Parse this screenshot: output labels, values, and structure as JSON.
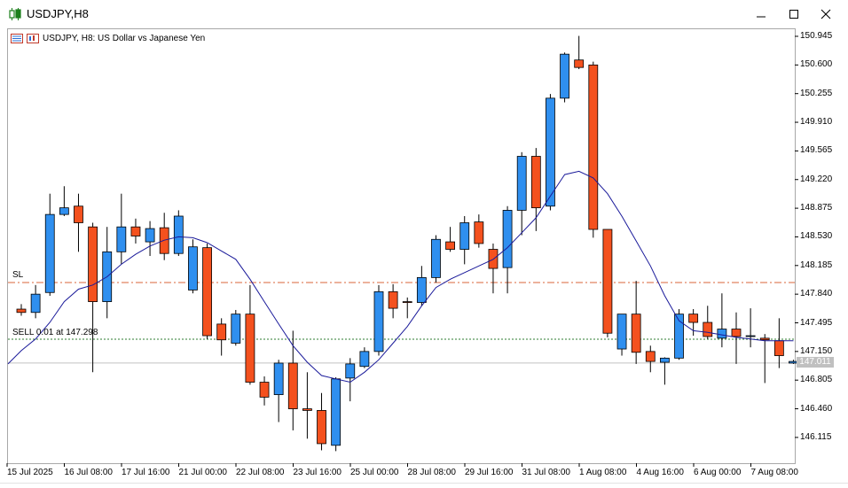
{
  "window": {
    "title": "USDJPY,H8"
  },
  "chart": {
    "header_text": "USDJPY, H8:  US Dollar vs Japanese Yen",
    "price_axis": [
      "150.945",
      "150.600",
      "150.255",
      "149.910",
      "149.565",
      "149.220",
      "148.875",
      "148.530",
      "148.185",
      "147.840",
      "147.495",
      "147.150",
      "146.805",
      "146.460",
      "146.115"
    ],
    "time_axis": [
      "15 Jul 2025",
      "16 Jul 08:00",
      "17 Jul 16:00",
      "21 Jul 00:00",
      "22 Jul 08:00",
      "23 Jul 16:00",
      "25 Jul 00:00",
      "28 Jul 08:00",
      "29 Jul 16:00",
      "31 Jul 08:00",
      "1 Aug 08:00",
      "4 Aug 16:00",
      "6 Aug 00:00",
      "7 Aug 08:00"
    ],
    "sl_label": "SL",
    "sl_price": 147.98,
    "trade_label": "SELL 0.01 at 147.298",
    "trade_price": 147.298,
    "current_price": "147.011",
    "colors": {
      "bull": "#2f8fef",
      "bear": "#f4511e",
      "ma": "#1a1a9a",
      "sl_line": "#d9643a",
      "trade_line": "#2e7d32"
    }
  },
  "chart_data": {
    "type": "candlestick",
    "symbol": "USDJPY",
    "timeframe": "H8",
    "ylim": [
      145.85,
      151.1
    ],
    "candles": [
      {
        "o": 147.66,
        "h": 147.72,
        "l": 147.58,
        "c": 147.62
      },
      {
        "o": 147.62,
        "h": 147.95,
        "l": 147.55,
        "c": 147.84
      },
      {
        "o": 147.86,
        "h": 149.05,
        "l": 147.82,
        "c": 148.8
      },
      {
        "o": 148.8,
        "h": 149.14,
        "l": 148.78,
        "c": 148.88
      },
      {
        "o": 148.9,
        "h": 149.05,
        "l": 148.35,
        "c": 148.7
      },
      {
        "o": 148.65,
        "h": 148.7,
        "l": 146.9,
        "c": 147.75
      },
      {
        "o": 147.75,
        "h": 148.65,
        "l": 147.55,
        "c": 148.35
      },
      {
        "o": 148.35,
        "h": 149.05,
        "l": 148.2,
        "c": 148.65
      },
      {
        "o": 148.65,
        "h": 148.75,
        "l": 148.45,
        "c": 148.54
      },
      {
        "o": 148.47,
        "h": 148.72,
        "l": 148.3,
        "c": 148.63
      },
      {
        "o": 148.64,
        "h": 148.82,
        "l": 148.25,
        "c": 148.33
      },
      {
        "o": 148.33,
        "h": 148.85,
        "l": 148.3,
        "c": 148.78
      },
      {
        "o": 147.89,
        "h": 148.5,
        "l": 147.85,
        "c": 148.41
      },
      {
        "o": 148.4,
        "h": 148.45,
        "l": 147.3,
        "c": 147.34
      },
      {
        "o": 147.48,
        "h": 147.55,
        "l": 147.1,
        "c": 147.29
      },
      {
        "o": 147.25,
        "h": 147.65,
        "l": 147.22,
        "c": 147.6
      },
      {
        "o": 147.6,
        "h": 147.95,
        "l": 146.75,
        "c": 146.78
      },
      {
        "o": 146.78,
        "h": 146.85,
        "l": 146.5,
        "c": 146.6
      },
      {
        "o": 146.63,
        "h": 147.05,
        "l": 146.3,
        "c": 147.01
      },
      {
        "o": 147.01,
        "h": 147.4,
        "l": 146.2,
        "c": 146.46
      },
      {
        "o": 146.46,
        "h": 146.9,
        "l": 146.1,
        "c": 146.44
      },
      {
        "o": 146.44,
        "h": 146.65,
        "l": 145.96,
        "c": 146.04
      },
      {
        "o": 146.02,
        "h": 146.84,
        "l": 145.95,
        "c": 146.82
      },
      {
        "o": 146.83,
        "h": 147.07,
        "l": 146.55,
        "c": 147.0
      },
      {
        "o": 146.97,
        "h": 147.2,
        "l": 146.95,
        "c": 147.15
      },
      {
        "o": 147.15,
        "h": 147.95,
        "l": 147.1,
        "c": 147.87
      },
      {
        "o": 147.87,
        "h": 147.96,
        "l": 147.55,
        "c": 147.67
      },
      {
        "o": 147.75,
        "h": 147.8,
        "l": 147.55,
        "c": 147.74
      },
      {
        "o": 147.74,
        "h": 148.18,
        "l": 147.7,
        "c": 148.04
      },
      {
        "o": 148.04,
        "h": 148.55,
        "l": 147.98,
        "c": 148.5
      },
      {
        "o": 148.47,
        "h": 148.65,
        "l": 148.35,
        "c": 148.38
      },
      {
        "o": 148.38,
        "h": 148.78,
        "l": 148.2,
        "c": 148.7
      },
      {
        "o": 148.71,
        "h": 148.8,
        "l": 148.4,
        "c": 148.45
      },
      {
        "o": 148.38,
        "h": 148.45,
        "l": 147.85,
        "c": 148.15
      },
      {
        "o": 148.16,
        "h": 148.9,
        "l": 147.85,
        "c": 148.85
      },
      {
        "o": 148.85,
        "h": 149.55,
        "l": 148.55,
        "c": 149.5
      },
      {
        "o": 149.5,
        "h": 149.6,
        "l": 148.6,
        "c": 148.88
      },
      {
        "o": 148.9,
        "h": 150.25,
        "l": 148.85,
        "c": 150.2
      },
      {
        "o": 150.2,
        "h": 150.75,
        "l": 150.15,
        "c": 150.73
      },
      {
        "o": 150.66,
        "h": 150.95,
        "l": 150.55,
        "c": 150.57
      },
      {
        "o": 150.6,
        "h": 150.64,
        "l": 148.52,
        "c": 148.62
      },
      {
        "o": 148.62,
        "h": 148.6,
        "l": 147.32,
        "c": 147.37
      },
      {
        "o": 147.18,
        "h": 147.6,
        "l": 147.1,
        "c": 147.6
      },
      {
        "o": 147.6,
        "h": 148.0,
        "l": 147.0,
        "c": 147.14
      },
      {
        "o": 147.15,
        "h": 147.22,
        "l": 146.9,
        "c": 147.03
      },
      {
        "o": 147.02,
        "h": 147.08,
        "l": 146.75,
        "c": 147.07
      },
      {
        "o": 147.07,
        "h": 147.66,
        "l": 147.05,
        "c": 147.6
      },
      {
        "o": 147.6,
        "h": 147.66,
        "l": 147.34,
        "c": 147.5
      },
      {
        "o": 147.5,
        "h": 147.7,
        "l": 147.3,
        "c": 147.33
      },
      {
        "o": 147.31,
        "h": 147.85,
        "l": 147.2,
        "c": 147.42
      },
      {
        "o": 147.42,
        "h": 147.62,
        "l": 147.0,
        "c": 147.33
      },
      {
        "o": 147.34,
        "h": 147.67,
        "l": 147.2,
        "c": 147.34
      },
      {
        "o": 147.31,
        "h": 147.36,
        "l": 146.77,
        "c": 147.29
      },
      {
        "o": 147.28,
        "h": 147.55,
        "l": 146.95,
        "c": 147.1
      },
      {
        "o": 147.01,
        "h": 147.05,
        "l": 147.0,
        "c": 147.03
      }
    ],
    "moving_average": [
      147.16,
      147.3,
      147.5,
      147.75,
      147.9,
      147.95,
      148.05,
      148.2,
      148.32,
      148.42,
      148.49,
      148.53,
      148.52,
      148.46,
      148.36,
      148.26,
      148.02,
      147.75,
      147.48,
      147.22,
      147.02,
      146.86,
      146.82,
      146.78,
      146.9,
      147.05,
      147.25,
      147.45,
      147.7,
      147.92,
      148.02,
      148.1,
      148.18,
      148.26,
      148.4,
      148.58,
      148.76,
      149.02,
      149.28,
      149.32,
      149.24,
      149.05,
      148.78,
      148.48,
      148.18,
      147.82,
      147.52,
      147.4,
      147.38,
      147.35,
      147.32,
      147.3,
      147.28,
      147.28,
      147.28
    ]
  }
}
